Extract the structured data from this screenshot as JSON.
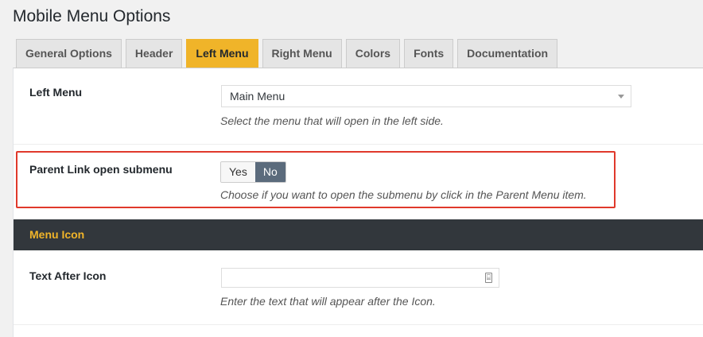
{
  "page": {
    "title": "Mobile Menu Options"
  },
  "tabs": [
    {
      "label": "General Options"
    },
    {
      "label": "Header"
    },
    {
      "label": "Left Menu",
      "active": true
    },
    {
      "label": "Right Menu"
    },
    {
      "label": "Colors"
    },
    {
      "label": "Fonts"
    },
    {
      "label": "Documentation"
    }
  ],
  "left_menu": {
    "label": "Left Menu",
    "selected_value": "Main Menu",
    "description": "Select the menu that will open in the left side."
  },
  "parent_link": {
    "label": "Parent Link open submenu",
    "options": [
      "Yes",
      "No"
    ],
    "selected": "No",
    "description": "Choose if you want to open the submenu by click in the Parent Menu item."
  },
  "menu_icon_section": {
    "title": "Menu Icon"
  },
  "text_after_icon": {
    "label": "Text After Icon",
    "value": "",
    "description": "Enter the text that will appear after the Icon."
  },
  "colors": {
    "accent": "#f0b429",
    "section_bar": "#32373c",
    "highlight_border": "#e0392b",
    "toggle_selected": "#5b6b7c"
  },
  "icons": {
    "select_caret": "chevron-down-icon",
    "input_icon": "keyboard-icon"
  }
}
